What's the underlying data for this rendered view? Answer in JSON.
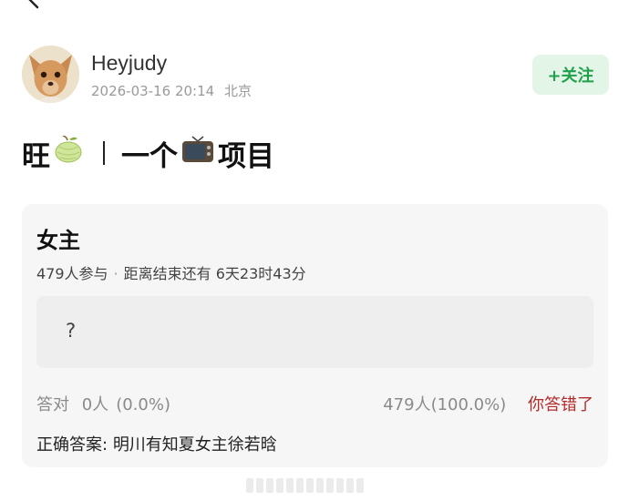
{
  "header": {
    "author_name": "Heyjudy",
    "post_date": "2026-03-16 20:14",
    "post_location": "北京",
    "follow_label": "+关注"
  },
  "post": {
    "title_part1": "旺",
    "title_part2": "一个",
    "title_part3": "项目",
    "emoji_1": "melon",
    "emoji_2": "television"
  },
  "poll": {
    "title": "女主",
    "participants": "479人参与",
    "countdown": "距离结束还有 6天23时43分",
    "option_text": "?",
    "correct_label": "答对",
    "correct_count": "0人",
    "correct_pct": "(0.0%)",
    "wrong_stats": "479人(100.0%)",
    "wrong_label": "你答错了",
    "answer_label": "正确答案:",
    "answer_value": "明川有知夏女主徐若晗"
  },
  "icons": {
    "back": "chevron-left-icon",
    "avatar": "dog-avatar"
  },
  "colors": {
    "follow_bg": "#e3f5e7",
    "follow_text": "#20a04a",
    "wrong_text": "#b32b2b",
    "card_bg": "#f6f6f6"
  }
}
